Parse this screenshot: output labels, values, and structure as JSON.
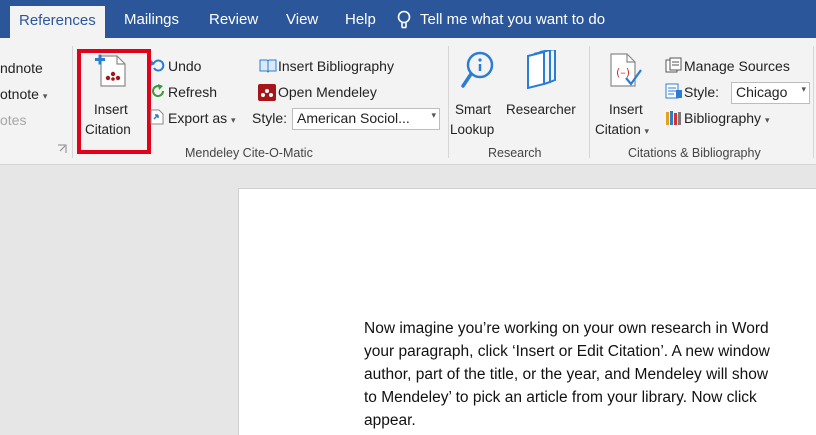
{
  "tabs": {
    "references": "References",
    "mailings": "Mailings",
    "review": "Review",
    "view": "View",
    "help": "Help",
    "tell_me": "Tell me what you want to do"
  },
  "footnotes_group": {
    "endnote": "ndnote",
    "footnote": "otnote",
    "notes": "otes"
  },
  "mendeley_group": {
    "insert_citation_line1": "Insert",
    "insert_citation_line2": "Citation",
    "undo": "Undo",
    "refresh": "Refresh",
    "export_as": "Export as",
    "insert_bibliography": "Insert Bibliography",
    "open_mendeley": "Open Mendeley",
    "style_label": "Style:",
    "style_value": "American Sociol...",
    "group_label": "Mendeley Cite-O-Matic"
  },
  "research_group": {
    "smart_lookup_line1": "Smart",
    "smart_lookup_line2": "Lookup",
    "researcher": "Researcher",
    "group_label": "Research"
  },
  "citations_group": {
    "insert_citation_line1": "Insert",
    "insert_citation_line2": "Citation",
    "manage_sources": "Manage Sources",
    "style_label": "Style:",
    "style_value": "Chicago",
    "bibliography": "Bibliography",
    "group_label": "Citations & Bibliography"
  },
  "document": {
    "lines": [
      "Now imagine you’re working on your own research in Word",
      "your paragraph, click ‘Insert or Edit Citation’. A new window",
      "author, part of the title, or the year, and Mendeley will show",
      "to Mendeley’ to pick an article from your library. Now click",
      "appear."
    ]
  },
  "colors": {
    "accent": "#2b579a",
    "highlight": "#e2001a",
    "mendeley": "#a4161a"
  }
}
